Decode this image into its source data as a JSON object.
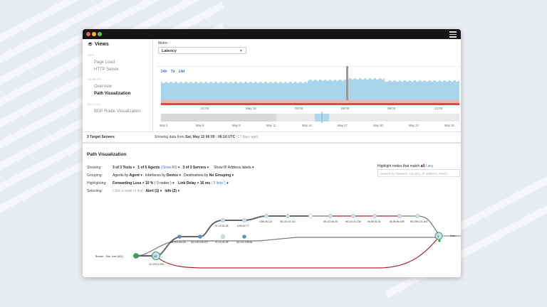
{
  "sidebar": {
    "title": "Views",
    "sections": [
      {
        "label": "WEB",
        "items": [
          {
            "label": "Page Load"
          },
          {
            "label": "HTTP Server"
          }
        ]
      },
      {
        "label": "NETWORK",
        "items": [
          {
            "label": "Overview"
          },
          {
            "label": "Path Visualization",
            "active": true
          }
        ]
      },
      {
        "label": "ROUTING",
        "items": [
          {
            "label": "BGP Route Visualization"
          }
        ]
      }
    ],
    "footer": "3 Target Servers"
  },
  "metric": {
    "label": "Metric",
    "value": "Latency"
  },
  "time_ranges": [
    "24h",
    "7d",
    "14d"
  ],
  "timeline": {
    "hour_ticks": [
      "21:00",
      "May 15",
      "03:00",
      "06:00",
      "09:00",
      "12:00"
    ],
    "date_ticks": [
      "May 2",
      "May 5",
      "May 8",
      "May 11",
      "May 14",
      "May 17",
      "May 20",
      "May 23",
      "May 26"
    ]
  },
  "showing_data": {
    "prefix": "Showing data from ",
    "range": "Sat, May 15 06:05 - 06:10 UTC",
    "ago": "(17 days ago)"
  },
  "path_viz": {
    "title": "Path Visualization",
    "showing_label": "Showing:",
    "tests": "3 of 3 Tests",
    "agents": "1 of 5 Agents",
    "show_all": "(Show All)",
    "servers": "3 of 3 Servers",
    "ip_labels": "Show IP Address labels",
    "grouping_label": "Grouping:",
    "group_agents_pre": "Agents by ",
    "group_agents": "Agent",
    "group_ifaces_pre": "Interfaces by ",
    "group_ifaces": "Device",
    "group_dest_pre": "Destinations by ",
    "group_dest": "No Grouping",
    "highlighting_label": "Highlighting:",
    "fwd_loss": "Forwarding Loss > 10 %",
    "fwd_nodes": "( 0 nodes )",
    "link_delay": "Link Delay > 16 ms",
    "link_links": "( 3 links )",
    "selecting_label": "Selecting:",
    "click_hint": "Click a node or link",
    "alert": "Alert (1)",
    "info": "Info (2)",
    "highlight_prefix": "Highlight nodes that match ",
    "highlight_all": "all",
    "highlight_sep": " / ",
    "highlight_any": "any",
    "search_placeholder": "Search by Network, Country, IP address, Prefix, ..."
  },
  "graph": {
    "source_label": "Branch - San Jose (841)",
    "source_ip": "10.203.0.254",
    "source_badge": "33",
    "dest_badge": "3",
    "dest_label": "Dest...",
    "top_row_labels": [
      "97.14.34.28",
      "4.69.62.77",
      "4.86.36.114",
      "96.110.32.241",
      "96.110.46.26",
      "96.110.41.234",
      "96.68.33.30",
      "65.86.96.198",
      "65.235.121.154"
    ],
    "mid_row_labels": [
      "66.116.144.83",
      "63.149.228.157",
      "97.14.41.28",
      "63.142.238.66"
    ]
  },
  "colors": {
    "accent": "#3a78c9",
    "chart_fill": "#a9d4ea",
    "loss_red": "#e0483f",
    "alert_red": "#b32424",
    "node": "#c7dff0",
    "node_dark": "#5b8fc0",
    "agent_green": "#3aa05a"
  }
}
